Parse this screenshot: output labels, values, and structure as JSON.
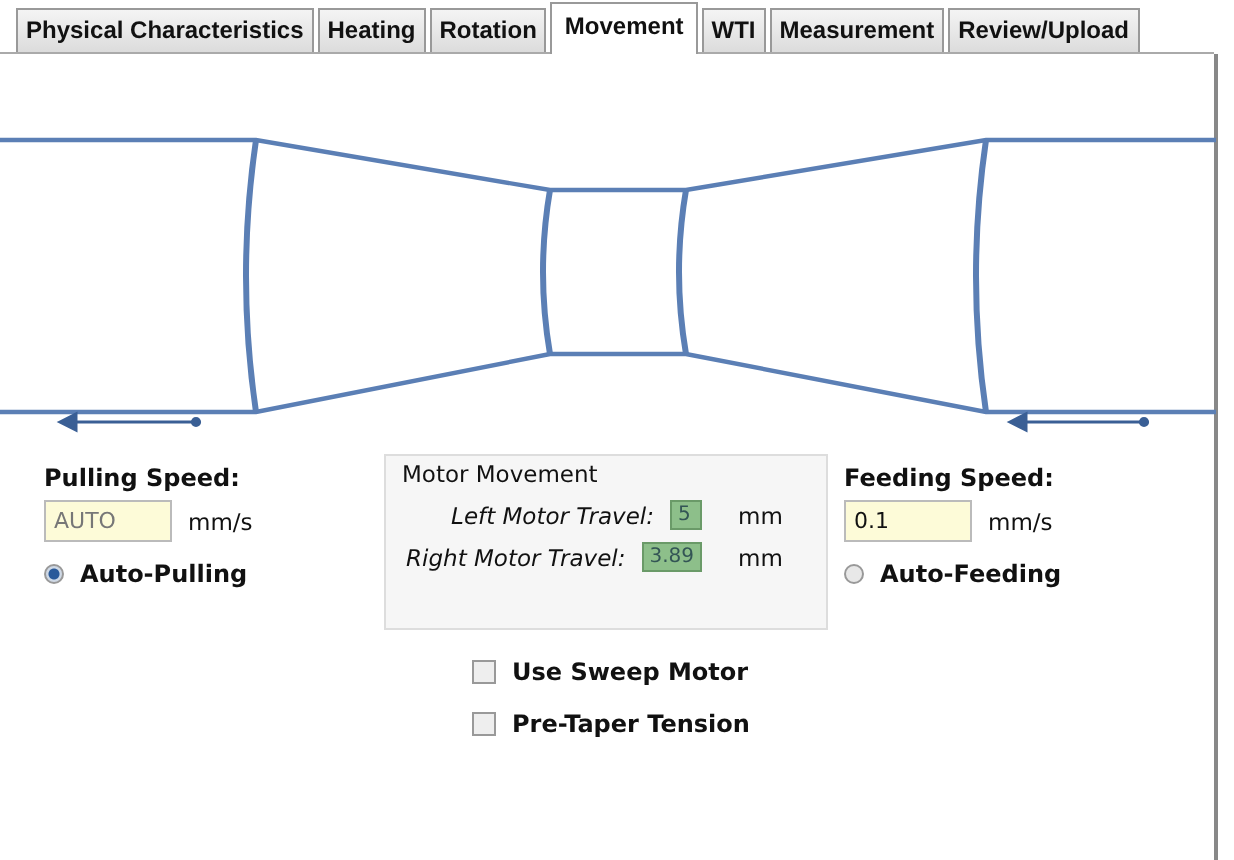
{
  "tabs": [
    {
      "label": "Physical Characteristics",
      "selected": false
    },
    {
      "label": "Heating",
      "selected": false
    },
    {
      "label": "Rotation",
      "selected": false
    },
    {
      "label": "Movement",
      "selected": true
    },
    {
      "label": "WTI",
      "selected": false
    },
    {
      "label": "Measurement",
      "selected": false
    },
    {
      "label": "Review/Upload",
      "selected": false
    }
  ],
  "pulling": {
    "label": "Pulling Speed:",
    "value": "AUTO",
    "disabled": true,
    "unit": "mm/s",
    "option": {
      "label": "Auto-Pulling",
      "selected": true
    }
  },
  "motor_movement": {
    "title": "Motor Movement",
    "rows": [
      {
        "label": "Left Motor Travel:",
        "value": "5",
        "unit": "mm"
      },
      {
        "label": "Right Motor Travel:",
        "value": "3.89",
        "unit": "mm"
      }
    ]
  },
  "feeding": {
    "label": "Feeding Speed:",
    "value": "0.1",
    "disabled": false,
    "unit": "mm/s",
    "option": {
      "label": "Auto-Feeding",
      "selected": false
    }
  },
  "checkboxes": [
    {
      "label": "Use Sweep Motor",
      "checked": false
    },
    {
      "label": "Pre-Taper Tension",
      "checked": false
    }
  ]
}
